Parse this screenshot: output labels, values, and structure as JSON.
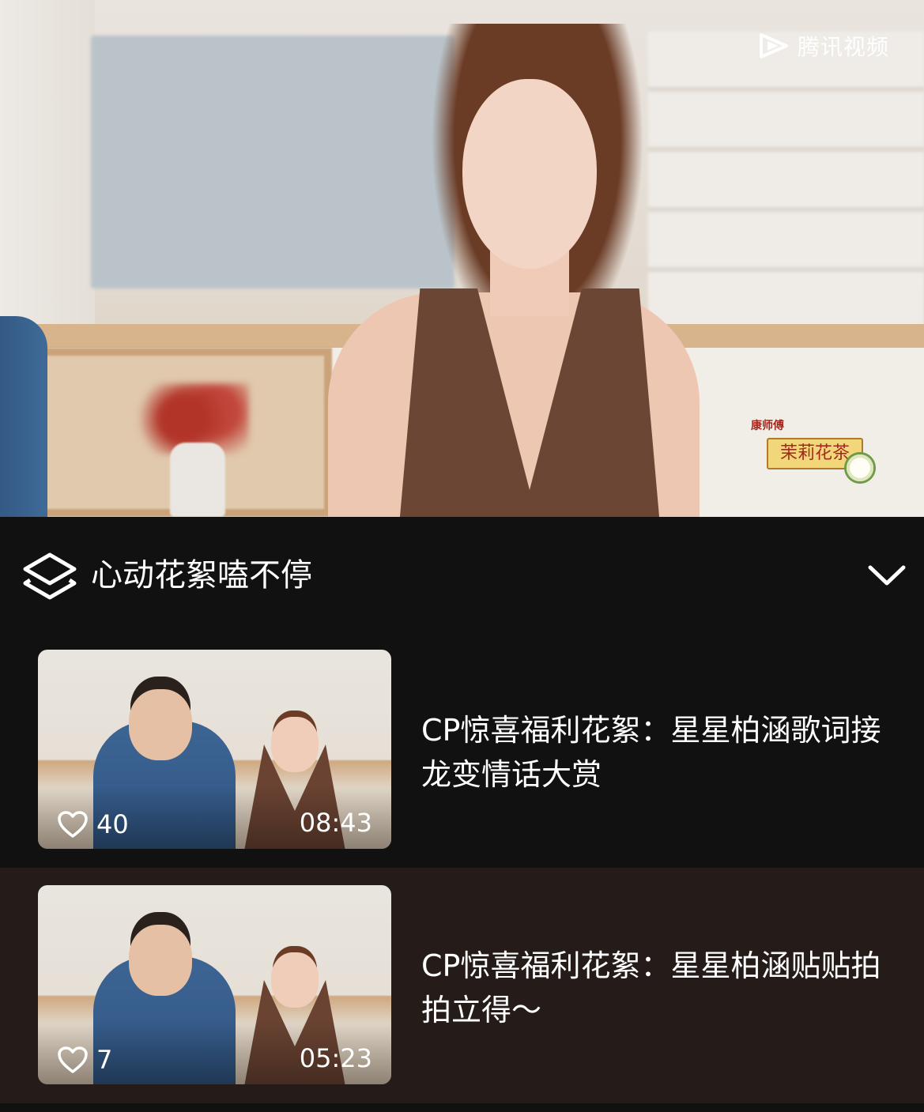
{
  "player": {
    "watermark": "腾讯视频",
    "sponsor": {
      "brand_small": "康师傅",
      "product": "茉莉花茶"
    }
  },
  "playlist": {
    "title": "心动花絮嗑不停",
    "items": [
      {
        "title": "CP惊喜福利花絮：星星柏涵歌词接龙变情话大赏",
        "likes": "40",
        "duration": "08:43",
        "selected": false
      },
      {
        "title": "CP惊喜福利花絮：星星柏涵贴贴拍拍立得～",
        "likes": "7",
        "duration": "05:23",
        "selected": true
      }
    ]
  },
  "icons": {
    "playlist": "layers-icon",
    "collapse": "chevron-down-icon",
    "like": "heart-icon",
    "brand": "tencent-video-logo-icon"
  },
  "colors": {
    "panel_bg": "#111111",
    "selected_row_bg": "#251b18",
    "text": "#ffffff"
  }
}
